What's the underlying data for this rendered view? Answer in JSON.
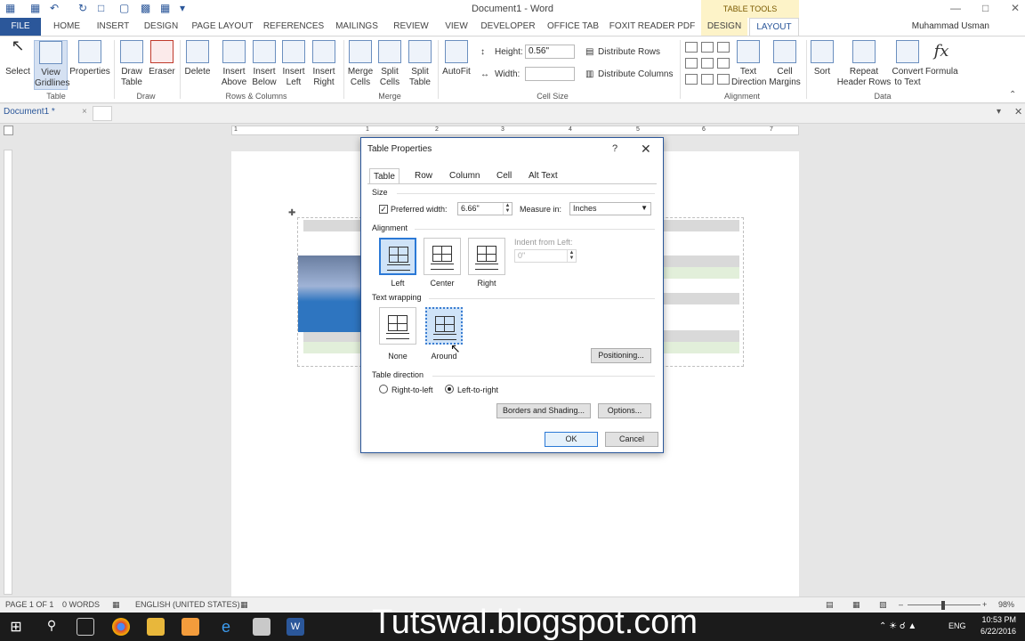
{
  "window": {
    "title": "Document1 - Word",
    "context_group": "TABLE TOOLS",
    "user_name": "Muhammad Usman"
  },
  "ribbon_tabs": [
    "FILE",
    "HOME",
    "INSERT",
    "DESIGN",
    "PAGE LAYOUT",
    "REFERENCES",
    "MAILINGS",
    "REVIEW",
    "VIEW",
    "DEVELOPER",
    "OFFICE TAB",
    "FOXIT READER PDF",
    "DESIGN",
    "LAYOUT"
  ],
  "ribbon": {
    "table_group": {
      "label": "Table",
      "select": "Select",
      "gridlines": "View Gridlines",
      "properties": "Properties"
    },
    "draw_group": {
      "label": "Draw",
      "draw_table": "Draw Table",
      "eraser": "Eraser"
    },
    "rows_cols_group": {
      "label": "Rows & Columns",
      "delete": "Delete",
      "insert_above": "Insert Above",
      "insert_below": "Insert Below",
      "insert_left": "Insert Left",
      "insert_right": "Insert Right"
    },
    "merge_group": {
      "label": "Merge",
      "merge_cells": "Merge Cells",
      "split_cells": "Split Cells",
      "split_table": "Split Table"
    },
    "cell_size_group": {
      "label": "Cell Size",
      "autofit": "AutoFit",
      "height_label": "Height:",
      "height_value": "0.56\"",
      "width_label": "Width:",
      "width_value": "",
      "distribute_rows": "Distribute Rows",
      "distribute_columns": "Distribute Columns"
    },
    "alignment_group": {
      "label": "Alignment",
      "text_direction": "Text Direction",
      "cell_margins": "Cell Margins"
    },
    "data_group": {
      "label": "Data",
      "sort": "Sort",
      "repeat_header": "Repeat Header Rows",
      "convert": "Convert to Text",
      "formula": "Formula"
    }
  },
  "doc_tab": "Document1 *",
  "dialog": {
    "title": "Table Properties",
    "tabs": [
      "Table",
      "Row",
      "Column",
      "Cell",
      "Alt Text"
    ],
    "size_label": "Size",
    "preferred_width_label": "Preferred width:",
    "preferred_width_checked": true,
    "preferred_width_value": "6.66\"",
    "measure_in_label": "Measure in:",
    "measure_in_value": "Inches",
    "alignment_label": "Alignment",
    "alignment_options": [
      "Left",
      "Center",
      "Right"
    ],
    "alignment_selected": "Left",
    "indent_label": "Indent from Left:",
    "indent_value": "0\"",
    "text_wrapping_label": "Text wrapping",
    "wrapping_options": [
      "None",
      "Around"
    ],
    "wrapping_selected": "Around",
    "positioning_button": "Positioning...",
    "table_direction_label": "Table direction",
    "direction_options": [
      "Right-to-left",
      "Left-to-right"
    ],
    "direction_selected": "Left-to-right",
    "borders_button": "Borders and Shading...",
    "options_button": "Options...",
    "ok_button": "OK",
    "cancel_button": "Cancel"
  },
  "status_bar": {
    "page": "PAGE 1 OF 1",
    "words": "0 WORDS",
    "language": "ENGLISH (UNITED STATES)",
    "zoom": "98%"
  },
  "taskbar": {
    "watermark": "Tutswal.blogspot.com",
    "language": "ENG",
    "time": "10:53 PM",
    "date": "6/22/2016"
  },
  "ruler_numbers": [
    "1",
    "1",
    "2",
    "3",
    "4",
    "5",
    "6",
    "7"
  ],
  "colors": {
    "accent": "#2b579a",
    "table_gray": "#d9d9d9",
    "table_blue": "#2e75c0",
    "table_green": "#e2efda"
  }
}
